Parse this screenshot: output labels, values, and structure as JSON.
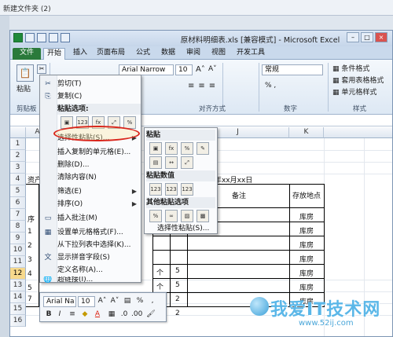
{
  "outer_title": "新建文件夹 (2)",
  "window_title": "原材料明细表.xls [兼容模式] - Microsoft Excel",
  "tabs": [
    "文件",
    "开始",
    "插入",
    "页面布局",
    "公式",
    "数据",
    "审阅",
    "视图",
    "开发工具"
  ],
  "ribbon": {
    "paste_label": "粘贴",
    "clipboard_group": "剪贴板",
    "font_name": "Arial Narrow",
    "font_size": "10",
    "align_group": "对齐方式",
    "number_format": "常规",
    "number_group": "数字",
    "cond_format": "条件格式",
    "table_format": "套用表格格式",
    "cell_style": "单元格样式",
    "style_group": "样式"
  },
  "columns": [
    "A",
    "B",
    "C",
    "D",
    "J",
    "K"
  ],
  "rows": [
    "1",
    "2",
    "3",
    "4",
    "5",
    "6",
    "7",
    "8",
    "9",
    "10",
    "11",
    "12",
    "13",
    "14",
    "15",
    "16"
  ],
  "sheet": {
    "date_text": "xxx年xx月xx日",
    "left_prefix": "资产",
    "seq_prefix": "序",
    "remark_header": "备注",
    "location_header": "存放地点",
    "row_numbers": [
      "1",
      "2",
      "3",
      "4",
      "5",
      "6",
      "7"
    ],
    "row_numbers_partial": [
      "1",
      "2",
      "3",
      "4",
      "5",
      "6",
      "7"
    ],
    "units": [
      "个",
      "个",
      "支",
      "个"
    ],
    "qty": [
      "5",
      "5",
      "2",
      "2"
    ],
    "locations": [
      "库房",
      "库房",
      "库房",
      "库房",
      "库房",
      "库房",
      "库房"
    ]
  },
  "context_menu": {
    "items": [
      {
        "icon": "✂",
        "label": "剪切(T)"
      },
      {
        "icon": "⎘",
        "label": "复制(C)"
      }
    ],
    "paste_options_header": "粘贴选项:",
    "paste_option_icons": [
      "123",
      "fx"
    ],
    "paste_special": "选择性粘贴(S)...",
    "items2": [
      {
        "label": "插入复制的单元格(E)..."
      },
      {
        "label": "删除(D)..."
      },
      {
        "label": "清除内容(N)"
      }
    ],
    "items3": [
      {
        "label": "筛选(E)"
      },
      {
        "label": "排序(O)"
      }
    ],
    "items4": [
      {
        "label": "插入批注(M)"
      },
      {
        "label": "设置单元格格式(F)..."
      },
      {
        "label": "从下拉列表中选择(K)..."
      },
      {
        "label": "显示拼音字段(S)"
      },
      {
        "label": "定义名称(A)..."
      },
      {
        "label": "超链接(I)..."
      }
    ]
  },
  "submenu": {
    "paste_header": "粘贴",
    "paste_icons": [
      "fx",
      "%"
    ],
    "values_header": "粘贴数值",
    "value_icons": [
      "123",
      "123",
      "123"
    ],
    "other_header": "其他粘贴选项",
    "special_link": "选择性粘贴(S)..."
  },
  "mini_toolbar": {
    "font": "Arial Na",
    "size": "10",
    "buttons": [
      "B",
      "I",
      "A"
    ]
  },
  "watermark": {
    "big": "我爱IT技术网",
    "small": "www.52ij.com"
  }
}
